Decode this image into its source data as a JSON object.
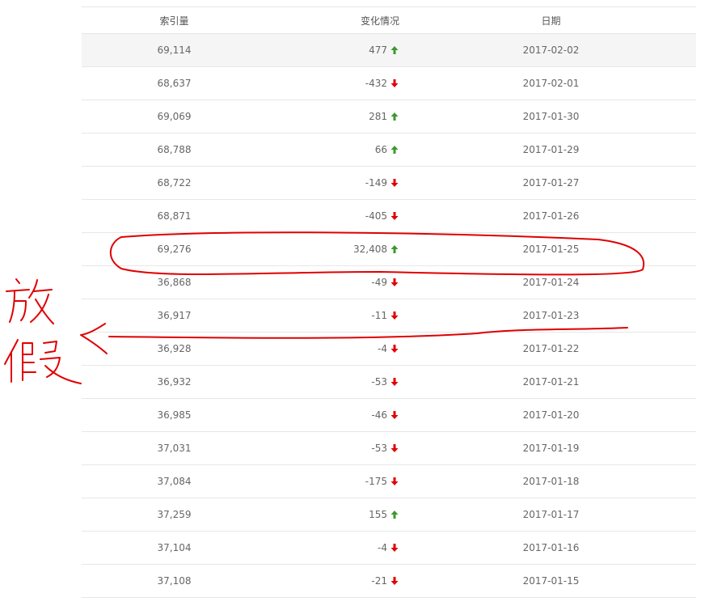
{
  "table": {
    "headers": {
      "index": "索引量",
      "change": "变化情况",
      "date": "日期"
    },
    "rows": [
      {
        "index": "69,114",
        "change": "477",
        "direction": "up",
        "date": "2017-02-02"
      },
      {
        "index": "68,637",
        "change": "-432",
        "direction": "down",
        "date": "2017-02-01"
      },
      {
        "index": "69,069",
        "change": "281",
        "direction": "up",
        "date": "2017-01-30"
      },
      {
        "index": "68,788",
        "change": "66",
        "direction": "up",
        "date": "2017-01-29"
      },
      {
        "index": "68,722",
        "change": "-149",
        "direction": "down",
        "date": "2017-01-27"
      },
      {
        "index": "68,871",
        "change": "-405",
        "direction": "down",
        "date": "2017-01-26"
      },
      {
        "index": "69,276",
        "change": "32,408",
        "direction": "up",
        "date": "2017-01-25"
      },
      {
        "index": "36,868",
        "change": "-49",
        "direction": "down",
        "date": "2017-01-24"
      },
      {
        "index": "36,917",
        "change": "-11",
        "direction": "down",
        "date": "2017-01-23"
      },
      {
        "index": "36,928",
        "change": "-4",
        "direction": "down",
        "date": "2017-01-22"
      },
      {
        "index": "36,932",
        "change": "-53",
        "direction": "down",
        "date": "2017-01-21"
      },
      {
        "index": "36,985",
        "change": "-46",
        "direction": "down",
        "date": "2017-01-20"
      },
      {
        "index": "37,031",
        "change": "-53",
        "direction": "down",
        "date": "2017-01-19"
      },
      {
        "index": "37,084",
        "change": "-175",
        "direction": "down",
        "date": "2017-01-18"
      },
      {
        "index": "37,259",
        "change": "155",
        "direction": "up",
        "date": "2017-01-17"
      },
      {
        "index": "37,104",
        "change": "-4",
        "direction": "down",
        "date": "2017-01-16"
      },
      {
        "index": "37,108",
        "change": "-21",
        "direction": "down",
        "date": "2017-01-15"
      }
    ]
  },
  "annotation": {
    "text": "放假",
    "color": "#e00000"
  },
  "colors": {
    "up": "#3a9a2c",
    "down": "#e00000"
  },
  "icons": {
    "up": "arrow-up-icon",
    "down": "arrow-down-icon"
  }
}
